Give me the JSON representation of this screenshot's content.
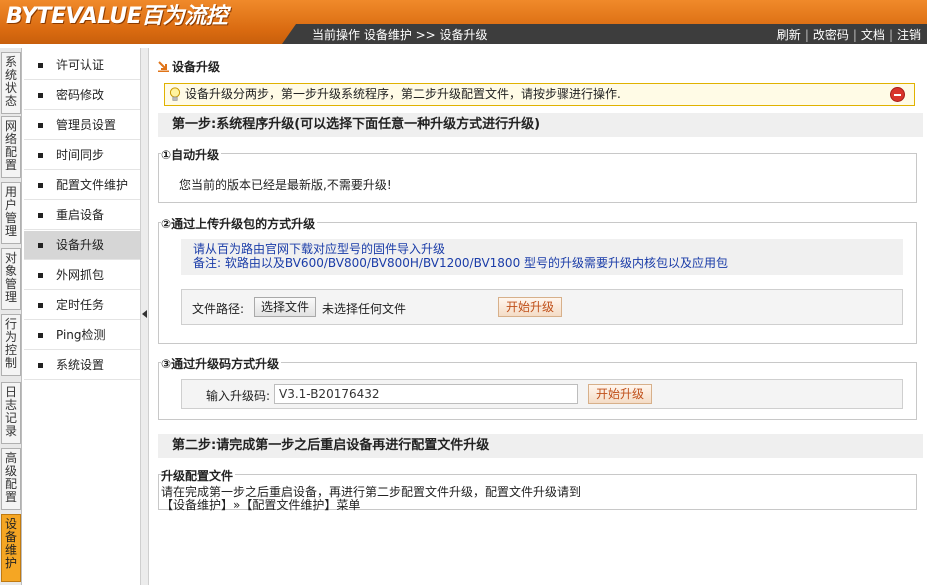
{
  "header": {
    "logo": "BYTEVALUE百为流控",
    "breadcrumb": "当前操作  设备维护 >> 设备升级",
    "links": [
      "刷新",
      "改密码",
      "文档",
      "注销"
    ]
  },
  "left_tabs": [
    {
      "label": "系统状态",
      "active": false
    },
    {
      "label": "网络配置",
      "active": false
    },
    {
      "label": "用户管理",
      "active": false
    },
    {
      "label": "对象管理",
      "active": false
    },
    {
      "label": "行为控制",
      "active": false
    },
    {
      "label": "日志记录",
      "active": false
    },
    {
      "label": "高级配置",
      "active": false
    },
    {
      "label": "设备维护",
      "active": true
    }
  ],
  "subnav": [
    {
      "label": "许可认证",
      "active": false
    },
    {
      "label": "密码修改",
      "active": false
    },
    {
      "label": "管理员设置",
      "active": false
    },
    {
      "label": "时间同步",
      "active": false
    },
    {
      "label": "配置文件维护",
      "active": false
    },
    {
      "label": "重启设备",
      "active": false
    },
    {
      "label": "设备升级",
      "active": true
    },
    {
      "label": "外网抓包",
      "active": false
    },
    {
      "label": "定时任务",
      "active": false
    },
    {
      "label": "Ping检测",
      "active": false
    },
    {
      "label": "系统设置",
      "active": false
    }
  ],
  "main": {
    "title": "设备升级",
    "notice": "设备升级分两步，第一步升级系统程序，第二步升级配置文件，请按步骤进行操作.",
    "step1_header": "第一步:系统程序升级(可以选择下面任意一种升级方式进行升级)",
    "auto": {
      "legend": "①自动升级",
      "message": "您当前的版本已经是最新版,不需要升级!"
    },
    "upload": {
      "legend": "②通过上传升级包的方式升级",
      "info_line1": "请从百为路由官网下载对应型号的固件导入升级",
      "info_line2": "备注: 软路由以及BV600/BV800/BV800H/BV1200/BV1800 型号的升级需要升级内核包以及应用包",
      "file_label": "文件路径:",
      "choose_button": "选择文件",
      "no_file": "未选择任何文件",
      "start_button": "开始升级"
    },
    "code": {
      "legend": "③通过升级码方式升级",
      "input_label": "输入升级码:",
      "input_value": "V3.1-B20176432",
      "start_button": "开始升级"
    },
    "step2_header": "第二步:请完成第一步之后重启设备再进行配置文件升级",
    "config": {
      "legend": "升级配置文件",
      "line1": "请在完成第一步之后重启设备，再进行第二步配置文件升级，配置文件升级请到",
      "line2": "【设备维护】»【配置文件维护】菜单"
    }
  },
  "colors": {
    "header_orange": "#e07418",
    "active_tab": "#f5a623",
    "info_blue": "#1a3ca8",
    "button_text": "#c0501a"
  }
}
